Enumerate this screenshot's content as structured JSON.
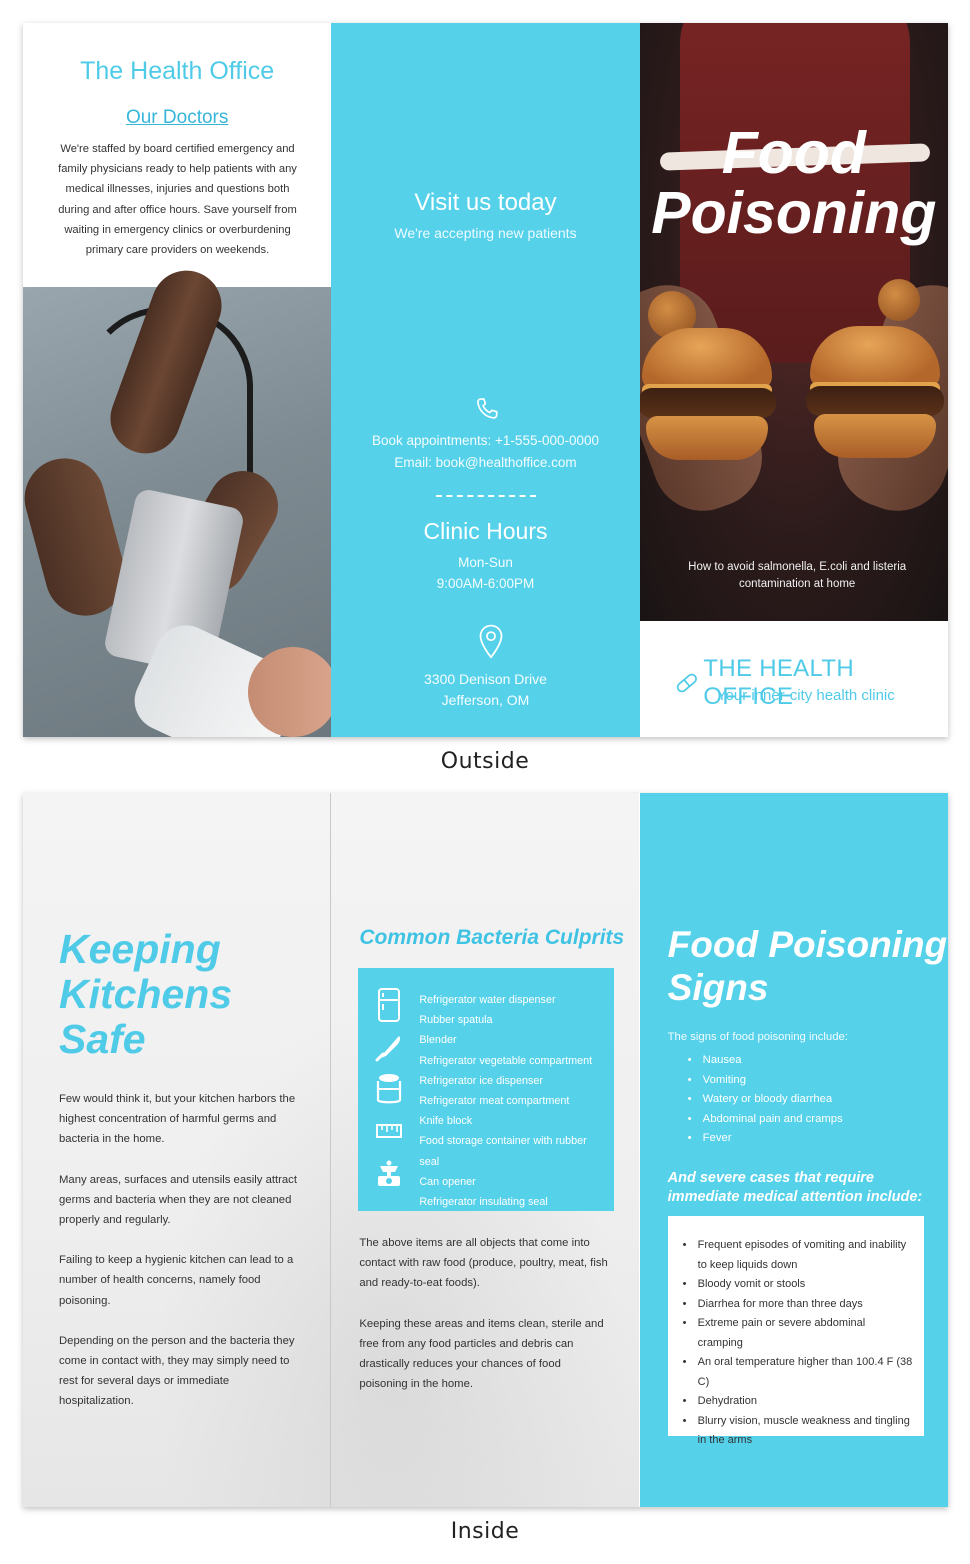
{
  "outside": {
    "caption": "Outside",
    "panel1": {
      "title": "The Health Office",
      "subtitle": "Our Doctors",
      "body": "We're staffed by board certified emergency and family physicians ready to help patients with any medical illnesses, injuries and questions both during and after office hours. Save yourself from waiting in emergency clinics or overburdening primary care providers on weekends."
    },
    "panel2": {
      "visit_title": "Visit us today",
      "visit_sub": "We're accepting new patients",
      "phone_line": "Book appointments: +1-555-000-0000",
      "email_line": "Email: book@healthoffice.com",
      "hours_title": "Clinic Hours",
      "days": "Mon-Sun",
      "hours": "9:00AM-6:00PM",
      "address_line1": "3300 Denison Drive",
      "address_line2": "Jefferson, OM"
    },
    "panel3": {
      "title_line1": "Food",
      "title_line2": "Poisoning",
      "tagline": "How to avoid salmonella, E.coli and listeria contamination at home",
      "brand_name": "THE HEALTH OFFICE",
      "brand_sub": "Your inner-city health clinic"
    }
  },
  "inside": {
    "caption": "Inside",
    "panel1": {
      "title_line1": "Keeping",
      "title_line2": "Kitchens",
      "title_line3": "Safe",
      "paragraphs": [
        "Few would think it, but your kitchen harbors the highest concentration of harmful germs and bacteria in the home.",
        "Many areas, surfaces and utensils easily attract germs and bacteria when they are not cleaned properly and regularly.",
        "Failing to keep a hygienic kitchen can lead to a number of health concerns, namely food poisoning.",
        "Depending on the person and the bacteria they come in contact with, they may simply need to rest for several days or immediate hospitalization."
      ]
    },
    "panel2": {
      "title": "Common Bacteria Culprits",
      "icons": [
        "refrigerator-icon",
        "knife-icon",
        "food-container-icon",
        "measuring-icon",
        "scale-icon"
      ],
      "items": [
        "Refrigerator water dispenser",
        "Rubber spatula",
        "Blender",
        "Refrigerator vegetable compartment",
        "Refrigerator ice dispenser",
        "Refrigerator meat compartment",
        "Knife block",
        "Food storage container with rubber seal",
        "Can opener",
        "Refrigerator insulating seal"
      ],
      "paragraphs": [
        "The above items are all objects that come into contact with raw food (produce, poultry, meat, fish and ready-to-eat foods).",
        "Keeping these areas and items clean, sterile and free from any food particles and debris can drastically reduces your chances of food poisoning in the home."
      ]
    },
    "panel3": {
      "title_line1": "Food Poisoning",
      "title_line2": "Signs",
      "intro": "The signs of food poisoning include:",
      "signs": [
        "Nausea",
        "Vomiting",
        "Watery or bloody diarrhea",
        "Abdominal pain and cramps",
        "Fever"
      ],
      "severe_heading": "And severe cases that require immediate medical attention include:",
      "severe": [
        "Frequent episodes of vomiting and inability to keep liquids down",
        "Bloody vomit or stools",
        "Diarrhea for more than three days",
        "Extreme pain or severe abdominal cramping",
        "An oral temperature higher than 100.4 F (38 C)",
        "Dehydration",
        "Blurry vision, muscle weakness and tingling in the arms"
      ]
    }
  },
  "colors": {
    "accent": "#55d1ea",
    "accent_text": "#4fcbe8",
    "body_text": "#333333"
  }
}
